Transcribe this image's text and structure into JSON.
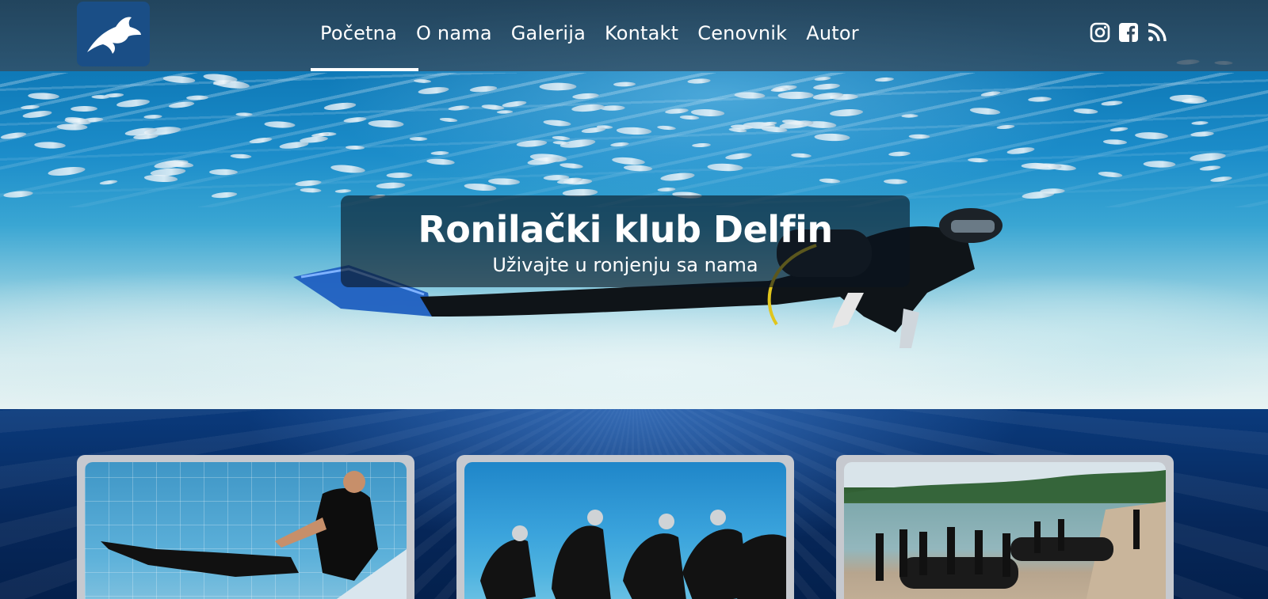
{
  "site": {
    "logo_icon": "dolphin-icon"
  },
  "nav": {
    "items": [
      {
        "label": "Početna",
        "active": true
      },
      {
        "label": "O nama"
      },
      {
        "label": "Galerija"
      },
      {
        "label": "Kontakt"
      },
      {
        "label": "Cenovnik"
      },
      {
        "label": "Autor"
      }
    ]
  },
  "social": {
    "icons": [
      "instagram-icon",
      "facebook-icon",
      "rss-icon"
    ]
  },
  "hero": {
    "title": "Ronilački klub Delfin",
    "subtitle": "Uživajte u ronjenju sa nama"
  },
  "cards": [
    {
      "image": "pool-freediving-training-photo"
    },
    {
      "image": "group-scuba-pool-training-photo"
    },
    {
      "image": "beach-boat-divers-photo"
    }
  ],
  "colors": {
    "header_bg": "#344c60",
    "logo_bg": "#1a4e86",
    "section_bg": "#06275a",
    "card_frame": "#c6c9cf"
  }
}
